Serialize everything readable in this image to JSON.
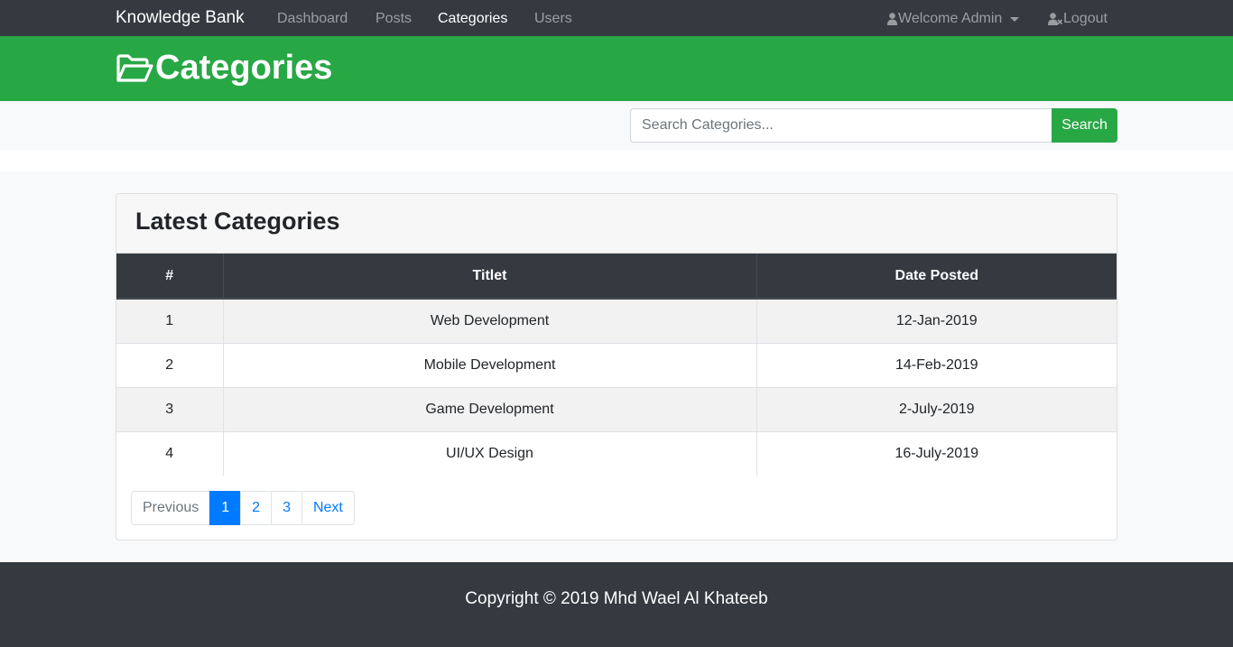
{
  "navbar": {
    "brand": "Knowledge Bank",
    "links": [
      "Dashboard",
      "Posts",
      "Categories",
      "Users"
    ],
    "active": "Categories",
    "welcome": "Welcome Admin",
    "logout": "Logout",
    "user_icon": "user-icon",
    "logout_icon": "user-times-icon"
  },
  "header": {
    "title": "Categories",
    "icon": "folder-open-icon",
    "color": "#28a745"
  },
  "search": {
    "placeholder": "Search Categories...",
    "button": "Search"
  },
  "card": {
    "title": "Latest Categories",
    "columns": [
      "#",
      "Titlet",
      "Date Posted"
    ],
    "rows": [
      {
        "num": "1",
        "title": "Web Development",
        "date": "12-Jan-2019"
      },
      {
        "num": "2",
        "title": "Mobile Development",
        "date": "14-Feb-2019"
      },
      {
        "num": "3",
        "title": "Game Development",
        "date": "2-July-2019"
      },
      {
        "num": "4",
        "title": "UI/UX Design",
        "date": "16-July-2019"
      }
    ]
  },
  "pagination": {
    "previous": "Previous",
    "pages": [
      "1",
      "2",
      "3"
    ],
    "active_page": "1",
    "next": "Next"
  },
  "footer": {
    "text": "Copyright © 2019 Mhd Wael Al Khateeb"
  },
  "colors": {
    "navbar": "#343a40",
    "success": "#28a745",
    "primary": "#007bff"
  }
}
